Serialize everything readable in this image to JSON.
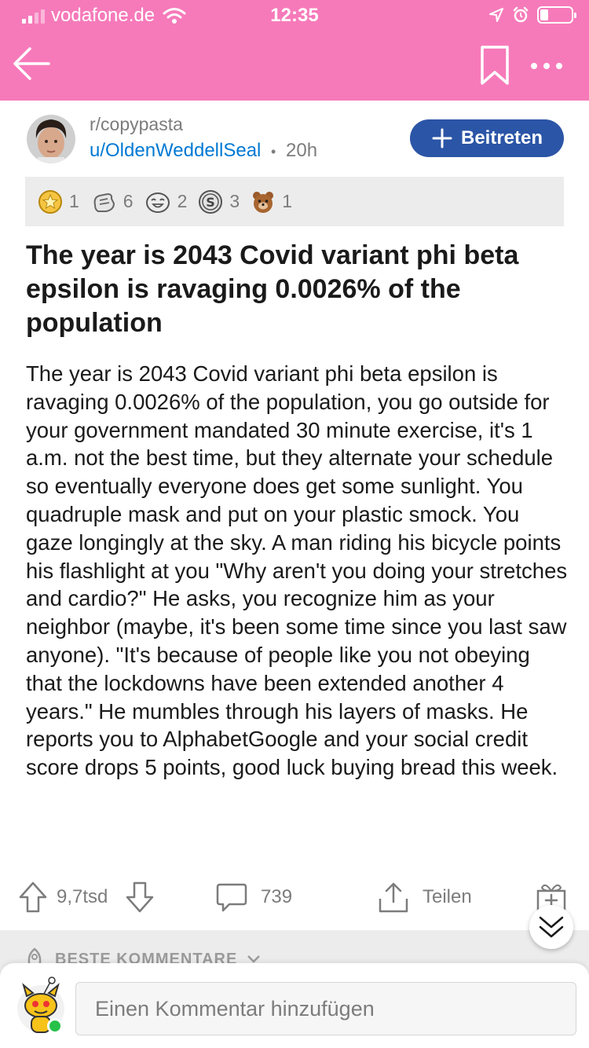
{
  "status_bar": {
    "carrier": "vodafone.de",
    "time": "12:35",
    "battery_level": 0.25
  },
  "nav": {
    "back_icon": "arrow-left-icon",
    "bookmark_icon": "bookmark-icon",
    "more_icon": "more-horizontal-icon"
  },
  "post": {
    "subreddit": "r/copypasta",
    "author": "u/OldenWeddellSeal",
    "separator": "•",
    "age": "20h",
    "join_label": "Beitreten",
    "awards": [
      {
        "icon": "gold-star-award-icon",
        "count": "1"
      },
      {
        "icon": "hand-wave-award-icon",
        "count": "6"
      },
      {
        "icon": "laughing-face-award-icon",
        "count": "2"
      },
      {
        "icon": "silver-award-icon",
        "count": "3"
      },
      {
        "icon": "bear-award-icon",
        "count": "1"
      }
    ],
    "title": "The year is 2043 Covid variant phi beta epsilon is ravaging 0.0026% of the population",
    "body": "The year is 2043 Covid variant phi beta epsilon is ravaging 0.0026% of the population, you go outside for your government mandated 30 minute exercise, it's 1 a.m. not the best time, but they alternate your schedule so eventually everyone does get some sunlight. You quadruple mask and put on your plastic smock. You gaze longingly at the sky. A man riding his bicycle points his flashlight at you \"Why aren't you doing your stretches and cardio?\" He asks, you recognize him as your neighbor (maybe, it's been some time since you last saw anyone). \"It's because of people like you not obeying that the lockdowns have been extended another 4 years.\" He mumbles through his layers of masks. He reports you to AlphabetGoogle and your social credit score drops 5 points, good luck buying bread this week."
  },
  "actions": {
    "votes": "9,7tsd",
    "comments": "739",
    "share_label": "Teilen"
  },
  "comments_section": {
    "sort_label": "BESTE KOMMENTARE"
  },
  "comment_box": {
    "placeholder": "Einen Kommentar hinzufügen"
  }
}
